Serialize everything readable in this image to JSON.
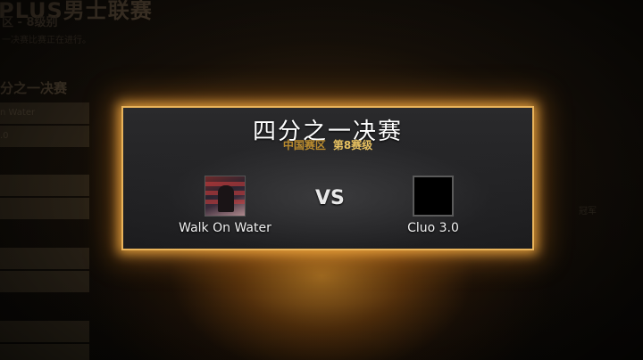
{
  "background": {
    "title": "PLUS男士联赛",
    "subtitle": "区 - 8级别",
    "note": "一决赛比赛正在进行。",
    "section_heading": "分之一决赛",
    "slots": [
      "n Water",
      ".0",
      "",
      "",
      "",
      "",
      "",
      ""
    ],
    "right_label": "冠军"
  },
  "match": {
    "title": "四分之一决赛",
    "region": "中国赛区",
    "level": "第8赛级",
    "vs_label": "VS",
    "team_left": {
      "name": "Walk On Water",
      "logo": "album-art-logo"
    },
    "team_right": {
      "name": "Cluo 3.0",
      "logo": "blank-black-logo"
    }
  },
  "colors": {
    "accent_border": "#e9b35a",
    "region_text": "#b88a2e",
    "level_text": "#e6c060"
  }
}
